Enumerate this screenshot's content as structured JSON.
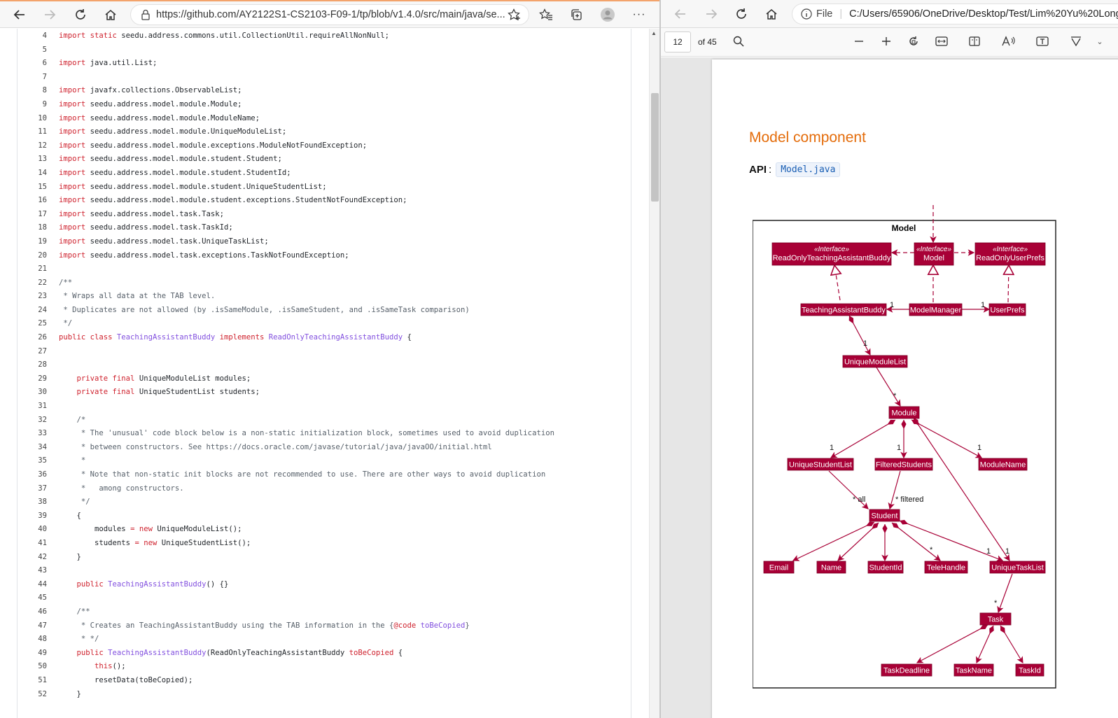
{
  "left_browser": {
    "url": "https://github.com/AY2122S1-CS2103-F09-1/tp/blob/v1.4.0/src/main/java/se...",
    "more_label": "···",
    "code_lines": [
      {
        "n": "4",
        "tokens": [
          [
            "kw",
            "import static "
          ],
          [
            "",
            "seedu.address.commons.util.CollectionUtil.requireAllNonNull;"
          ]
        ]
      },
      {
        "n": "5",
        "tokens": []
      },
      {
        "n": "6",
        "tokens": [
          [
            "kw",
            "import "
          ],
          [
            "",
            "java.util.List;"
          ]
        ]
      },
      {
        "n": "7",
        "tokens": []
      },
      {
        "n": "8",
        "tokens": [
          [
            "kw",
            "import "
          ],
          [
            "",
            "javafx.collections.ObservableList;"
          ]
        ]
      },
      {
        "n": "9",
        "tokens": [
          [
            "kw",
            "import "
          ],
          [
            "",
            "seedu.address.model.module.Module;"
          ]
        ]
      },
      {
        "n": "10",
        "tokens": [
          [
            "kw",
            "import "
          ],
          [
            "",
            "seedu.address.model.module.ModuleName;"
          ]
        ]
      },
      {
        "n": "11",
        "tokens": [
          [
            "kw",
            "import "
          ],
          [
            "",
            "seedu.address.model.module.UniqueModuleList;"
          ]
        ]
      },
      {
        "n": "12",
        "tokens": [
          [
            "kw",
            "import "
          ],
          [
            "",
            "seedu.address.model.module.exceptions.ModuleNotFoundException;"
          ]
        ]
      },
      {
        "n": "13",
        "tokens": [
          [
            "kw",
            "import "
          ],
          [
            "",
            "seedu.address.model.module.student.Student;"
          ]
        ]
      },
      {
        "n": "14",
        "tokens": [
          [
            "kw",
            "import "
          ],
          [
            "",
            "seedu.address.model.module.student.StudentId;"
          ]
        ]
      },
      {
        "n": "15",
        "tokens": [
          [
            "kw",
            "import "
          ],
          [
            "",
            "seedu.address.model.module.student.UniqueStudentList;"
          ]
        ]
      },
      {
        "n": "16",
        "tokens": [
          [
            "kw",
            "import "
          ],
          [
            "",
            "seedu.address.model.module.student.exceptions.StudentNotFoundException;"
          ]
        ]
      },
      {
        "n": "17",
        "tokens": [
          [
            "kw",
            "import "
          ],
          [
            "",
            "seedu.address.model.task.Task;"
          ]
        ]
      },
      {
        "n": "18",
        "tokens": [
          [
            "kw",
            "import "
          ],
          [
            "",
            "seedu.address.model.task.TaskId;"
          ]
        ]
      },
      {
        "n": "19",
        "tokens": [
          [
            "kw",
            "import "
          ],
          [
            "",
            "seedu.address.model.task.UniqueTaskList;"
          ]
        ]
      },
      {
        "n": "20",
        "tokens": [
          [
            "kw",
            "import "
          ],
          [
            "",
            "seedu.address.model.task.exceptions.TaskNotFoundException;"
          ]
        ]
      },
      {
        "n": "21",
        "tokens": []
      },
      {
        "n": "22",
        "tokens": [
          [
            "cm",
            "/**"
          ]
        ]
      },
      {
        "n": "23",
        "tokens": [
          [
            "cm",
            " * Wraps all data at the TAB level."
          ]
        ]
      },
      {
        "n": "24",
        "tokens": [
          [
            "cm",
            " * Duplicates are not allowed (by .isSameModule, .isSameStudent, and .isSameTask comparison)"
          ]
        ]
      },
      {
        "n": "25",
        "tokens": [
          [
            "cm",
            " */"
          ]
        ]
      },
      {
        "n": "26",
        "tokens": [
          [
            "kw",
            "public class "
          ],
          [
            "cls",
            "TeachingAssistantBuddy"
          ],
          [
            "kw",
            " implements "
          ],
          [
            "cls",
            "ReadOnlyTeachingAssistantBuddy"
          ],
          [
            "",
            " {"
          ]
        ]
      },
      {
        "n": "27",
        "tokens": []
      },
      {
        "n": "28",
        "tokens": []
      },
      {
        "n": "29",
        "tokens": [
          [
            "",
            "    "
          ],
          [
            "kw",
            "private final "
          ],
          [
            "",
            "UniqueModuleList modules;"
          ]
        ]
      },
      {
        "n": "30",
        "tokens": [
          [
            "",
            "    "
          ],
          [
            "kw",
            "private final "
          ],
          [
            "",
            "UniqueStudentList students;"
          ]
        ]
      },
      {
        "n": "31",
        "tokens": []
      },
      {
        "n": "32",
        "tokens": [
          [
            "cm",
            "    /*"
          ]
        ]
      },
      {
        "n": "33",
        "tokens": [
          [
            "cm",
            "     * The 'unusual' code block below is a non-static initialization block, sometimes used to avoid duplication"
          ]
        ]
      },
      {
        "n": "34",
        "tokens": [
          [
            "cm",
            "     * between constructors. See https://docs.oracle.com/javase/tutorial/java/javaOO/initial.html"
          ]
        ]
      },
      {
        "n": "35",
        "tokens": [
          [
            "cm",
            "     *"
          ]
        ]
      },
      {
        "n": "36",
        "tokens": [
          [
            "cm",
            "     * Note that non-static init blocks are not recommended to use. There are other ways to avoid duplication"
          ]
        ]
      },
      {
        "n": "37",
        "tokens": [
          [
            "cm",
            "     *   among constructors."
          ]
        ]
      },
      {
        "n": "38",
        "tokens": [
          [
            "cm",
            "     */"
          ]
        ]
      },
      {
        "n": "39",
        "tokens": [
          [
            "",
            "    {"
          ]
        ]
      },
      {
        "n": "40",
        "tokens": [
          [
            "",
            "        modules "
          ],
          [
            "kw",
            "="
          ],
          [
            "kw",
            " new "
          ],
          [
            "",
            "UniqueModuleList();"
          ]
        ]
      },
      {
        "n": "41",
        "tokens": [
          [
            "",
            "        students "
          ],
          [
            "kw",
            "="
          ],
          [
            "kw",
            " new "
          ],
          [
            "",
            "UniqueStudentList();"
          ]
        ]
      },
      {
        "n": "42",
        "tokens": [
          [
            "",
            "    }"
          ]
        ]
      },
      {
        "n": "43",
        "tokens": []
      },
      {
        "n": "44",
        "tokens": [
          [
            "",
            "    "
          ],
          [
            "kw",
            "public "
          ],
          [
            "cls",
            "TeachingAssistantBuddy"
          ],
          [
            "",
            "() {}"
          ]
        ]
      },
      {
        "n": "45",
        "tokens": []
      },
      {
        "n": "46",
        "tokens": [
          [
            "cm",
            "    /**"
          ]
        ]
      },
      {
        "n": "47",
        "tokens": [
          [
            "cm",
            "     * Creates an TeachingAssistantBuddy using the TAB information in the {"
          ],
          [
            "kw",
            "@code"
          ],
          [
            "cm",
            " "
          ],
          [
            "cls",
            "toBeCopied"
          ],
          [
            "cm",
            "}"
          ]
        ]
      },
      {
        "n": "48",
        "tokens": [
          [
            "cm",
            "     * */"
          ]
        ]
      },
      {
        "n": "49",
        "tokens": [
          [
            "",
            "    "
          ],
          [
            "kw",
            "public "
          ],
          [
            "cls",
            "TeachingAssistantBuddy"
          ],
          [
            "",
            "(ReadOnlyTeachingAssistantBuddy "
          ],
          [
            "kw",
            "toBeCopied"
          ],
          [
            "",
            " {"
          ]
        ]
      },
      {
        "n": "50",
        "tokens": [
          [
            "",
            "        "
          ],
          [
            "kw",
            "this"
          ],
          [
            "",
            "();"
          ]
        ]
      },
      {
        "n": "51",
        "tokens": [
          [
            "",
            "        resetData(toBeCopied);"
          ]
        ]
      },
      {
        "n": "52",
        "tokens": [
          [
            "",
            "    }"
          ]
        ]
      }
    ]
  },
  "right_browser": {
    "file_label": "File",
    "path": "C:/Users/65906/OneDrive/Desktop/Test/Lim%20Yu%20Long",
    "page_number": "12",
    "of_pages": "of 45",
    "title": "Model component",
    "api_label": "API",
    "api_colon": ":",
    "api_link": "Model.java"
  },
  "diagram": {
    "package": "Model",
    "nodes": {
      "ro_tab": {
        "stereo": "«Interface»",
        "label": "ReadOnlyTeachingAssistantBuddy"
      },
      "model": {
        "stereo": "«Interface»",
        "label": "Model"
      },
      "ro_prefs": {
        "stereo": "«Interface»",
        "label": "ReadOnlyUserPrefs"
      },
      "tab": {
        "label": "TeachingAssistantBuddy"
      },
      "manager": {
        "label": "ModelManager"
      },
      "prefs": {
        "label": "UserPrefs"
      },
      "uml": {
        "label": "UniqueModuleList"
      },
      "module": {
        "label": "Module"
      },
      "usl": {
        "label": "UniqueStudentList"
      },
      "filtered": {
        "label": "FilteredStudents"
      },
      "modname": {
        "label": "ModuleName"
      },
      "student": {
        "label": "Student"
      },
      "email": {
        "label": "Email"
      },
      "name": {
        "label": "Name"
      },
      "sid": {
        "label": "StudentId"
      },
      "tele": {
        "label": "TeleHandle"
      },
      "utl": {
        "label": "UniqueTaskList"
      },
      "task": {
        "label": "Task"
      },
      "deadline": {
        "label": "TaskDeadline"
      },
      "tname": {
        "label": "TaskName"
      },
      "tid": {
        "label": "TaskId"
      }
    },
    "multiplicities": {
      "m1": "1",
      "m2": "1",
      "m3": "1",
      "m4": "*",
      "m5": "1",
      "m6": "1",
      "m7": "1",
      "m8": "* all",
      "m9": "* filtered",
      "m10": "*",
      "m11": "1",
      "m12": "1",
      "m13": "*"
    },
    "colors": {
      "node_fill": "#a80036",
      "line": "#a80036",
      "text": "#ffffff"
    }
  }
}
